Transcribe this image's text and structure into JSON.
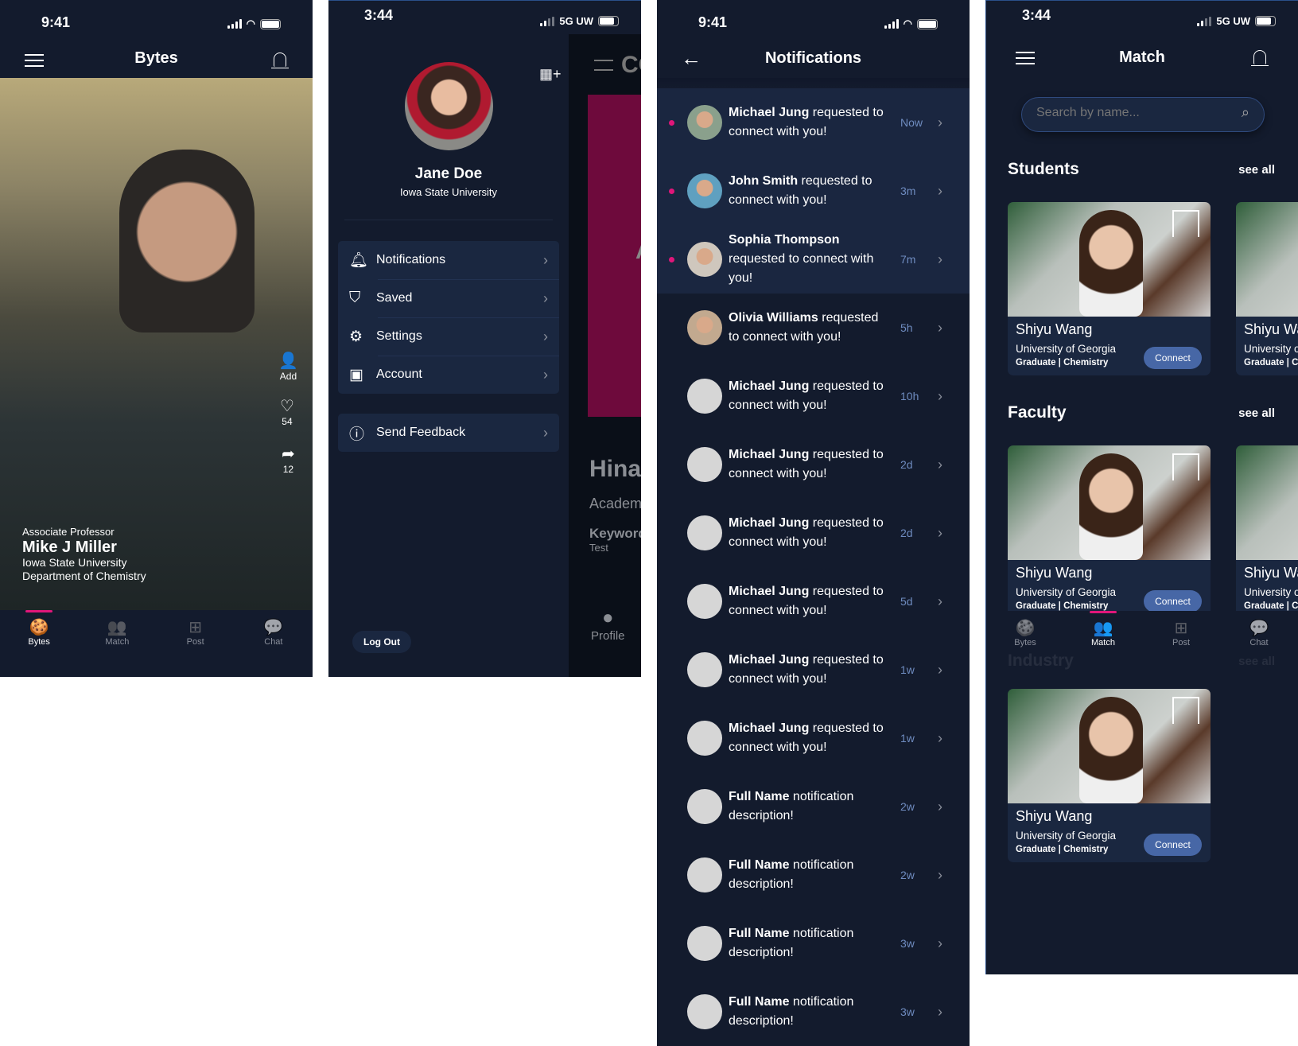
{
  "colors": {
    "background": "#131b2d",
    "accent": "#e0167a",
    "card": "#1a2740",
    "button": "#4767a6",
    "time_text": "#6f8cc0"
  },
  "bytes": {
    "status_time": "9:41",
    "title": "Bytes",
    "post": {
      "role": "Associate Professor",
      "name": "Mike J Miller",
      "university": "Iowa State University",
      "department": "Department of Chemistry"
    },
    "actions": {
      "add": "Add",
      "likes": "54",
      "shares": "12"
    },
    "nav": [
      {
        "label": "Bytes",
        "icon": "cookie-icon"
      },
      {
        "label": "Match",
        "icon": "users-icon"
      },
      {
        "label": "Post",
        "icon": "plus-square-icon"
      },
      {
        "label": "Chat",
        "icon": "chat-icon"
      }
    ],
    "active_nav": "Bytes"
  },
  "drawer": {
    "status_time": "3:44",
    "network": "5G UW",
    "name": "Jane Doe",
    "university": "Iowa State University",
    "menu": [
      {
        "label": "Notifications",
        "icon": "bell-icon"
      },
      {
        "label": "Saved",
        "icon": "bookmark-icon"
      },
      {
        "label": "Settings",
        "icon": "gear-icon"
      },
      {
        "label": "Account",
        "icon": "account-icon"
      }
    ],
    "feedback": {
      "label": "Send Feedback",
      "icon": "help-icon"
    },
    "logout": "Log Out",
    "preview": {
      "title": "CO",
      "banner_letter": "A",
      "name": "Hina",
      "subtitle": "Academ",
      "keywords_label": "Keyword",
      "keywords": "Test",
      "nav_label": "Profile"
    }
  },
  "notifications": {
    "status_time": "9:41",
    "title": "Notifications",
    "items": [
      {
        "name": "Michael Jung",
        "text": "requested to connect with you!",
        "time": "Now",
        "unread": true,
        "photo": true
      },
      {
        "name": "John Smith",
        "text": "requested to connect with you!",
        "time": "3m",
        "unread": true,
        "photo": true
      },
      {
        "name": "Sophia Thompson",
        "text": "requested to connect with you!",
        "time": "7m",
        "unread": true,
        "photo": true
      },
      {
        "name": "Olivia Williams",
        "text": "requested to connect with you!",
        "time": "5h",
        "unread": false,
        "photo": true
      },
      {
        "name": "Michael Jung",
        "text": "requested to connect with you!",
        "time": "10h",
        "unread": false,
        "photo": false
      },
      {
        "name": "Michael Jung",
        "text": "requested to connect with you!",
        "time": "2d",
        "unread": false,
        "photo": false
      },
      {
        "name": "Michael Jung",
        "text": "requested to connect with you!",
        "time": "2d",
        "unread": false,
        "photo": false
      },
      {
        "name": "Michael Jung",
        "text": "requested to connect with you!",
        "time": "5d",
        "unread": false,
        "photo": false
      },
      {
        "name": "Michael Jung",
        "text": "requested to connect with you!",
        "time": "1w",
        "unread": false,
        "photo": false
      },
      {
        "name": "Michael Jung",
        "text": "requested to connect with you!",
        "time": "1w",
        "unread": false,
        "photo": false
      },
      {
        "name": "Full Name",
        "text": "notification description!",
        "time": "2w",
        "unread": false,
        "photo": false
      },
      {
        "name": "Full Name",
        "text": "notification description!",
        "time": "2w",
        "unread": false,
        "photo": false
      },
      {
        "name": "Full Name",
        "text": "notification description!",
        "time": "3w",
        "unread": false,
        "photo": false
      },
      {
        "name": "Full Name",
        "text": "notification description!",
        "time": "3w",
        "unread": false,
        "photo": false
      }
    ]
  },
  "match": {
    "status_time": "3:44",
    "network": "5G UW",
    "title": "Match",
    "search_placeholder": "Search by name...",
    "sections": [
      {
        "title": "Students",
        "see_all": "see all"
      },
      {
        "title": "Faculty",
        "see_all": "see all"
      },
      {
        "title": "Industry",
        "see_all": "see all"
      }
    ],
    "card": {
      "name": "Shiyu Wang",
      "university": "University of Georgia",
      "detail": "Graduate | Chemistry",
      "button": "Connect",
      "partial_name": "Shiyu Wa",
      "partial_university": "University o",
      "partial_detail": "Graduate | Ch"
    },
    "active_nav": "Match"
  }
}
